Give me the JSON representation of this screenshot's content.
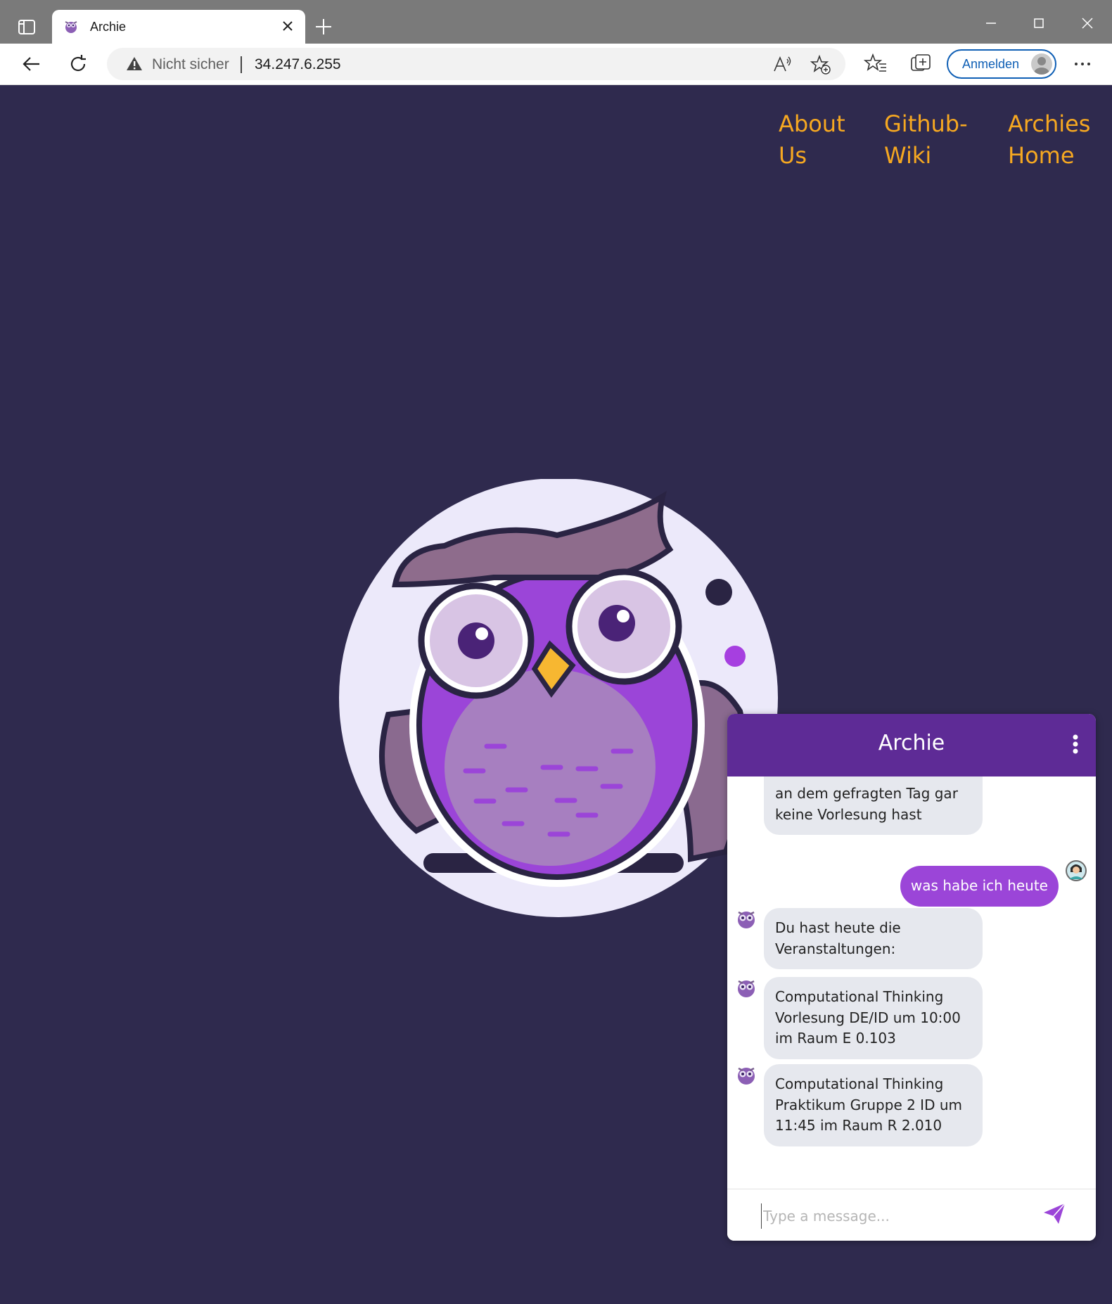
{
  "browser": {
    "tab_title": "Archie",
    "security_label": "Nicht sicher",
    "url": "34.247.6.255",
    "signin_label": "Anmelden"
  },
  "nav": {
    "about_line1": "About",
    "about_line2": "Us",
    "wiki_line1": "Github-",
    "wiki_line2": "Wiki",
    "home_line1": "Archies",
    "home_line2": "Home"
  },
  "chat": {
    "title": "Archie",
    "input_placeholder": "Type a message...",
    "messages": [
      {
        "sender": "bot",
        "text": "an dem gefragten Tag gar keine Vorlesung hast"
      },
      {
        "sender": "user",
        "text": "was habe ich heute"
      },
      {
        "sender": "bot",
        "text": "Du hast heute die Veranstaltungen:"
      },
      {
        "sender": "bot",
        "text": "Computational Thinking Vorlesung DE/ID um 10:00 im Raum E 0.103"
      },
      {
        "sender": "bot",
        "text": "Computational Thinking Praktikum Gruppe 2 ID um 11:45 im Raum R 2.010"
      }
    ]
  },
  "colors": {
    "page_background": "#2f2a4e",
    "nav_link": "#f6a821",
    "chat_header": "#5e2b96",
    "user_bubble": "#9b45d8",
    "bot_bubble": "#e6e8ee"
  }
}
